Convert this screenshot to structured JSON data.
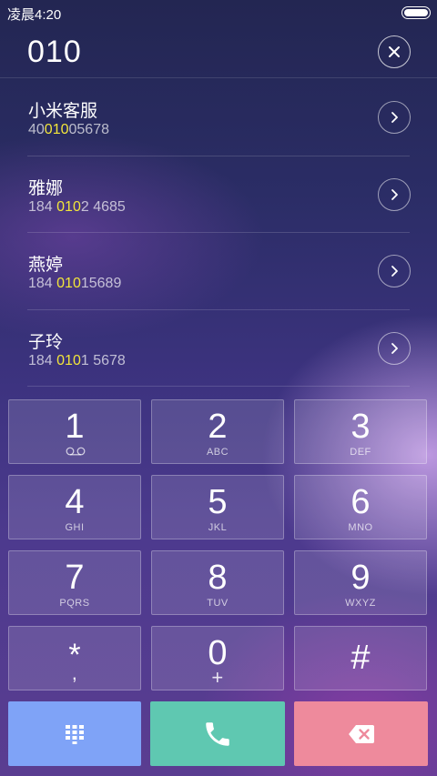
{
  "status": {
    "time": "凌晨4:20",
    "battery_level": 1.0
  },
  "dialer": {
    "input": "010"
  },
  "contacts": [
    {
      "name": "小米客服",
      "number_before": "40",
      "number_match": "010",
      "number_after": "05678"
    },
    {
      "name": "雅娜",
      "number_before": "184 ",
      "number_match": "010",
      "number_after": "2 4685"
    },
    {
      "name": "燕婷",
      "number_before": "184 ",
      "number_match": "010",
      "number_after": "15689"
    },
    {
      "name": "子玲",
      "number_before": "184 ",
      "number_match": "010",
      "number_after": "1 5678"
    }
  ],
  "keypad": {
    "keys": [
      {
        "digit": "1",
        "letters": ""
      },
      {
        "digit": "2",
        "letters": "ABC"
      },
      {
        "digit": "3",
        "letters": "DEF"
      },
      {
        "digit": "4",
        "letters": "GHI"
      },
      {
        "digit": "5",
        "letters": "JKL"
      },
      {
        "digit": "6",
        "letters": "MNO"
      },
      {
        "digit": "7",
        "letters": "PQRS"
      },
      {
        "digit": "8",
        "letters": "TUV"
      },
      {
        "digit": "9",
        "letters": "WXYZ"
      },
      {
        "digit": "*",
        "letters": ","
      },
      {
        "digit": "0",
        "letters": "+"
      },
      {
        "digit": "#",
        "letters": ""
      }
    ]
  },
  "colors": {
    "match_highlight": "#f2e53a",
    "keypad_toggle": "#7fa3f7",
    "call": "#5fc8b1",
    "delete": "#ee8a9c"
  },
  "icons": {
    "clear": "close-icon",
    "detail": "chevron-right-icon",
    "voicemail": "voicemail-icon",
    "keypad_toggle": "dialpad-icon",
    "call": "phone-icon",
    "delete": "backspace-icon"
  }
}
